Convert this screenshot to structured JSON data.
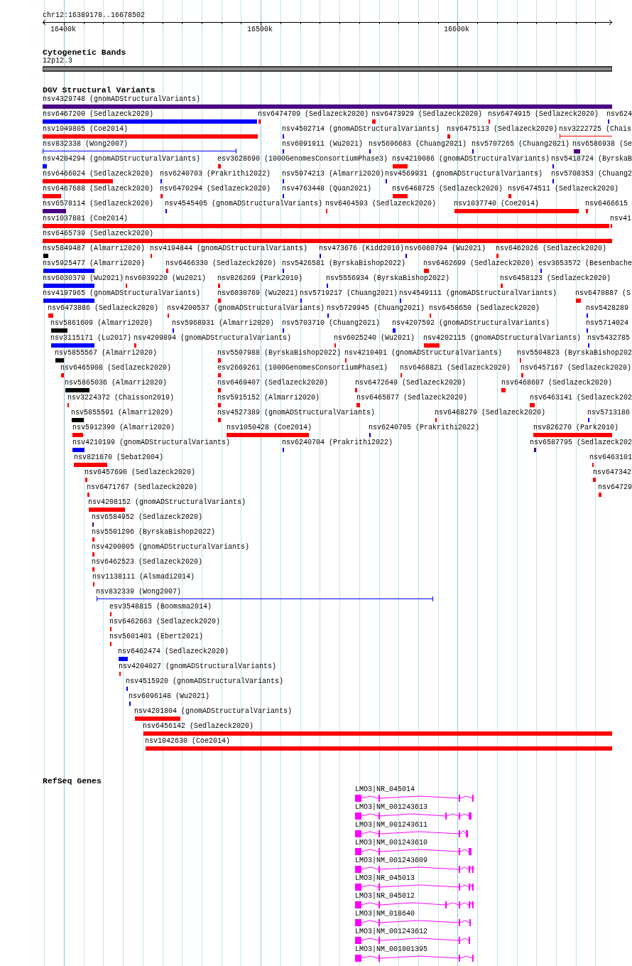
{
  "ruler": {
    "region": "chr12:16389178..16678502",
    "ticks": [
      "16400k",
      "16500k",
      "16600k"
    ]
  },
  "cytogenetic_bands": {
    "title": "Cytogenetic Bands",
    "band": {
      "label": "12p12.3"
    }
  },
  "dgv_structural_variants": {
    "title": "DGV Structural Variants",
    "rows": [
      {
        "features": [
          {
            "label": "nsv4329748 (gnomADStructuralVariants)",
            "color": "#4b0082",
            "kind": "bar"
          }
        ]
      },
      {
        "features": [
          {
            "label": "nsv6467200 (Sedlazeck2020)",
            "color": "#0000ff",
            "kind": "bar"
          },
          {
            "label": "nsv6474709 (Sedlazeck2020)",
            "color": "#ff0000",
            "kind": "bar"
          },
          {
            "label": "nsv6473929 (Sedlazeck2020)",
            "color": "#ff0000",
            "kind": "bar"
          },
          {
            "label": "nsv6474915 (Sedlazeck2020)",
            "color": "#ff0000",
            "kind": "bar"
          },
          {
            "label": "nsv624",
            "color": "#0000ff",
            "kind": "bar"
          }
        ]
      },
      {
        "features": [
          {
            "label": "nsv1049805 (Coe2014)",
            "color": "#ff0000",
            "kind": "bar"
          },
          {
            "label": "nsv4502714 (gnomADStructuralVariants)",
            "color": "#0000ff",
            "kind": "bar"
          },
          {
            "label": "nsv6475113 (Sedlazeck2020)",
            "color": "#ff0000",
            "kind": "bar"
          },
          {
            "label": "nsv3222725 (Chais",
            "color": "#ff0000",
            "kind": "span"
          }
        ]
      },
      {
        "features": [
          {
            "label": "nsv832338 (Wong2007)",
            "color": "#0000ff",
            "kind": "span"
          },
          {
            "label": "nsv6091911 (Wu2021)",
            "color": "#0000ff",
            "kind": "bar"
          },
          {
            "label": "nsv5696683 (Chuang2021)",
            "color": "#0000ff",
            "kind": "bar"
          },
          {
            "label": "nsv5707265 (Chuang2021)",
            "color": "#0000ff",
            "kind": "bar"
          },
          {
            "label": "nsv6586938 (Se",
            "color": "#4b0082",
            "kind": "bar"
          }
        ]
      },
      {
        "features": [
          {
            "label": "nsv4204294 (gnomADStructuralVariants)",
            "color": "#0000ff",
            "kind": "bar"
          },
          {
            "label": "esv3628690 (1000GenomesConsortiumPhase3)",
            "color": "#ff0000",
            "kind": "bar"
          },
          {
            "label": "nsv4210086 (gnomADStructuralVariants)",
            "color": "#ff0000",
            "kind": "bar"
          },
          {
            "label": "nsv5418724 (ByrskaB",
            "color": "#0000ff",
            "kind": "bar"
          }
        ]
      },
      {
        "features": [
          {
            "label": "nsv6466024 (Sedlazeck2020)",
            "color": "#ff0000",
            "kind": "bar"
          },
          {
            "label": "nsv6240703 (Prakrithi2022)",
            "color": "#0000ff",
            "kind": "bar"
          },
          {
            "label": "nsv5974213 (Almarri2020)",
            "color": "#0000ff",
            "kind": "bar"
          },
          {
            "label": "nsv4569931 (gnomADStructuralVariants)",
            "color": "#0000ff",
            "kind": "bar"
          },
          {
            "label": "nsv5708353 (Chuang2",
            "color": "#0000ff",
            "kind": "bar"
          }
        ]
      },
      {
        "features": [
          {
            "label": "nsv6467688 (Sedlazeck2020)",
            "color": "#ff0000",
            "kind": "bar"
          },
          {
            "label": "nsv6470294 (Sedlazeck2020)",
            "color": "#ff0000",
            "kind": "bar"
          },
          {
            "label": "nsv4763448 (Quan2021)",
            "color": "#0000ff",
            "kind": "bar"
          },
          {
            "label": "nsv6468725 (Sedlazeck2020)",
            "color": "#ff0000",
            "kind": "bar"
          },
          {
            "label": "nsv6474511 (Sedlazeck2020)",
            "color": "#ff0000",
            "kind": "bar"
          }
        ]
      },
      {
        "features": [
          {
            "label": "nsv6578114 (Sedlazeck2020)",
            "color": "#4b0082",
            "kind": "bar"
          },
          {
            "label": "nsv4545405 (gnomADStructuralVariants)",
            "color": "#0000ff",
            "kind": "bar"
          },
          {
            "label": "nsv6464593 (Sedlazeck2020)",
            "color": "#ff0000",
            "kind": "bar"
          },
          {
            "label": "nsv1037740 (Coe2014)",
            "color": "#ff0000",
            "kind": "bar"
          },
          {
            "label": "nsv6466615",
            "color": "#ff0000",
            "kind": "bar"
          }
        ]
      },
      {
        "features": [
          {
            "label": "nsv1037881 (Coe2014)",
            "color": "#ff0000",
            "kind": "bar"
          },
          {
            "label": "nsv41",
            "color": "#ff0000",
            "kind": "bar"
          }
        ]
      },
      {
        "features": [
          {
            "label": "nsv6465739 (Sedlazeck2020)",
            "color": "#ff0000",
            "kind": "bar"
          }
        ]
      },
      {
        "features": [
          {
            "label": "nsv5849487 (Almarri2020)",
            "color": "#000000",
            "kind": "bar"
          },
          {
            "label": "nsv4194844 (gnomADStructuralVariants)",
            "color": "#ff0000",
            "kind": "bar"
          },
          {
            "label": "nsv473676 (Kidd2010)",
            "color": "#0000ff",
            "kind": "bar"
          },
          {
            "label": "nsv6080794 (Wu2021)",
            "color": "#0000ff",
            "kind": "bar"
          },
          {
            "label": "nsv6462026 (Sedlazeck2020)",
            "color": "#ff0000",
            "kind": "bar"
          }
        ]
      },
      {
        "features": [
          {
            "label": "nsv5925477 (Almarri2020)",
            "color": "#0000ff",
            "kind": "bar"
          },
          {
            "label": "nsv6466330 (Sedlazeck2020)",
            "color": "#ff0000",
            "kind": "bar"
          },
          {
            "label": "nsv5426581 (ByrskaBishop2022)",
            "color": "#0000ff",
            "kind": "bar"
          },
          {
            "label": "nsv6462699 (Sedlazeck2020)",
            "color": "#ff0000",
            "kind": "bar"
          },
          {
            "label": "esv3653572 (Besenbache",
            "color": "#0000ff",
            "kind": "bar"
          }
        ]
      },
      {
        "features": [
          {
            "label": "nsv6030379 (Wu2021)",
            "color": "#0000ff",
            "kind": "bar"
          },
          {
            "label": "nsv6039220 (Wu2021)",
            "color": "#ff0000",
            "kind": "bar"
          },
          {
            "label": "nsv826269 (Park2010)",
            "color": "#ff0000",
            "kind": "bar"
          },
          {
            "label": "nsv5556934 (ByrskaBishop2022)",
            "color": "#0000ff",
            "kind": "bar"
          },
          {
            "label": "nsv6458123 (Sedlazeck2020)",
            "color": "#ff0000",
            "kind": "bar"
          }
        ]
      },
      {
        "features": [
          {
            "label": "nsv4197965 (gnomADStructuralVariants)",
            "color": "#0000ff",
            "kind": "bar"
          },
          {
            "label": "nsv6030769 (Wu2021)",
            "color": "#ff0000",
            "kind": "bar"
          },
          {
            "label": "nsv5719217 (Chuang2021)",
            "color": "#0000ff",
            "kind": "bar"
          },
          {
            "label": "nsv4549111 (gnomADStructuralVariants)",
            "color": "#0000ff",
            "kind": "bar"
          },
          {
            "label": "nsv6470887 (S",
            "color": "#ff0000",
            "kind": "bar"
          }
        ]
      },
      {
        "features": [
          {
            "label": "nsv6473886 (Sedlazeck2020)",
            "color": "#ff0000",
            "kind": "bar"
          },
          {
            "label": "nsv4200537 (gnomADStructuralVariants)",
            "color": "#ff0000",
            "kind": "bar"
          },
          {
            "label": "nsv5729945 (Chuang2021)",
            "color": "#0000ff",
            "kind": "bar"
          },
          {
            "label": "nsv6458650 (Sedlazeck2020)",
            "color": "#ff0000",
            "kind": "bar"
          },
          {
            "label": "nsv5428289",
            "color": "#0000ff",
            "kind": "bar"
          }
        ]
      },
      {
        "features": [
          {
            "label": "nsv5861609 (Almarri2020)",
            "color": "#000000",
            "kind": "bar"
          },
          {
            "label": "nsv5968931 (Almarri2020)",
            "color": "#0000ff",
            "kind": "bar"
          },
          {
            "label": "nsv5703710 (Chuang2021)",
            "color": "#0000ff",
            "kind": "bar"
          },
          {
            "label": "nsv4207592 (gnomADStructuralVariants)",
            "color": "#0000ff",
            "kind": "bar"
          },
          {
            "label": "nsv5714024",
            "color": "#0000ff",
            "kind": "bar"
          }
        ]
      },
      {
        "features": [
          {
            "label": "nsv3115171 (Lu2017)",
            "color": "#0000ff",
            "kind": "bar"
          },
          {
            "label": "nsv4209894 (gnomADStructuralVariants)",
            "color": "#ff0000",
            "kind": "bar"
          },
          {
            "label": "nsv6025240 (Wu2021)",
            "color": "#ff0000",
            "kind": "bar"
          },
          {
            "label": "nsv4202115 (gnomADStructuralVariants)",
            "color": "#ff0000",
            "kind": "bar"
          },
          {
            "label": "nsv5432785",
            "color": "#0000ff",
            "kind": "bar"
          }
        ]
      },
      {
        "features": [
          {
            "label": "nsv5855567 (Almarri2020)",
            "color": "#000000",
            "kind": "bar"
          },
          {
            "label": "nsv5507988 (ByrskaBishop2022)",
            "color": "#ff0000",
            "kind": "bar"
          },
          {
            "label": "nsv4210401 (gnomADStructuralVariants)",
            "color": "#ff0000",
            "kind": "bar"
          },
          {
            "label": "nsv5504823 (ByrskaBishop202",
            "color": "#ff0000",
            "kind": "bar"
          }
        ]
      },
      {
        "features": [
          {
            "label": "nsv6465908 (Sedlazeck2020)",
            "color": "#ff0000",
            "kind": "bar"
          },
          {
            "label": "esv2669261 (1000GenomesConsortiumPhase1)",
            "color": "#ff0000",
            "kind": "bar"
          },
          {
            "label": "nsv6468821 (Sedlazeck2020)",
            "color": "#ff0000",
            "kind": "bar"
          },
          {
            "label": "nsv6457167 (Sedlazeck2020)",
            "color": "#ff0000",
            "kind": "bar"
          }
        ]
      },
      {
        "features": [
          {
            "label": "nsv5865036 (Almarri2020)",
            "color": "#000000",
            "kind": "bar"
          },
          {
            "label": "nsv6469407 (Sedlazeck2020)",
            "color": "#ff0000",
            "kind": "bar"
          },
          {
            "label": "nsv6472649 (Sedlazeck2020)",
            "color": "#ff0000",
            "kind": "bar"
          },
          {
            "label": "nsv6468607 (Sedlazeck2020)",
            "color": "#ff0000",
            "kind": "bar"
          }
        ]
      },
      {
        "features": [
          {
            "label": "nsv3224372 (Chaisson2019)",
            "color": "#ff0000",
            "kind": "bar"
          },
          {
            "label": "nsv5915152 (Almarri2020)",
            "color": "#ff0000",
            "kind": "bar"
          },
          {
            "label": "nsv6465877 (Sedlazeck2020)",
            "color": "#ff0000",
            "kind": "bar"
          },
          {
            "label": "nsv6463141 (Sedlazeck202",
            "color": "#ff0000",
            "kind": "bar"
          }
        ]
      },
      {
        "features": [
          {
            "label": "nsv5855591 (Almarri2020)",
            "color": "#000000",
            "kind": "bar"
          },
          {
            "label": "nsv4527389 (gnomADStructuralVariants)",
            "color": "#ff0000",
            "kind": "bar"
          },
          {
            "label": "nsv6468279 (Sedlazeck2020)",
            "color": "#ff0000",
            "kind": "bar"
          },
          {
            "label": "nsv5713186",
            "color": "#0000ff",
            "kind": "bar"
          }
        ]
      },
      {
        "features": [
          {
            "label": "nsv5912390 (Almarri2020)",
            "color": "#ff0000",
            "kind": "bar"
          },
          {
            "label": "nsv1050428 (Coe2014)",
            "color": "#ff0000",
            "kind": "bar"
          },
          {
            "label": "nsv6240705 (Prakrithi2022)",
            "color": "#0000ff",
            "kind": "bar"
          },
          {
            "label": "nsv826270 (Park2010)",
            "color": "#ff0000",
            "kind": "bar"
          }
        ]
      },
      {
        "features": [
          {
            "label": "nsv4210199 (gnomADStructuralVariants)",
            "color": "#0000ff",
            "kind": "bar"
          },
          {
            "label": "nsv6240704 (Prakrithi2022)",
            "color": "#0000ff",
            "kind": "bar"
          },
          {
            "label": "nsv6587795 (Sedlazeck202",
            "color": "#4b0082",
            "kind": "bar"
          }
        ]
      },
      {
        "features": [
          {
            "label": "nsv821670 (Sebat2004)",
            "color": "#ff0000",
            "kind": "bar"
          },
          {
            "label": "nsv6463101",
            "color": "#ff0000",
            "kind": "bar"
          }
        ]
      },
      {
        "features": [
          {
            "label": "nsv6457690 (Sedlazeck2020)",
            "color": "#ff0000",
            "kind": "bar"
          },
          {
            "label": "nsv647342",
            "color": "#ff0000",
            "kind": "bar"
          }
        ]
      },
      {
        "features": [
          {
            "label": "nsv6471767 (Sedlazeck2020)",
            "color": "#ff0000",
            "kind": "bar"
          },
          {
            "label": "nsv64729",
            "color": "#ff0000",
            "kind": "bar"
          }
        ]
      },
      {
        "features": [
          {
            "label": "nsv4208152 (gnomADStructuralVariants)",
            "color": "#ff0000",
            "kind": "bar"
          }
        ]
      },
      {
        "features": [
          {
            "label": "nsv6584952 (Sedlazeck2020)",
            "color": "#4b0082",
            "kind": "bar"
          }
        ]
      },
      {
        "features": [
          {
            "label": "nsv5501206 (ByrskaBishop2022)",
            "color": "#ff0000",
            "kind": "bar"
          }
        ]
      },
      {
        "features": [
          {
            "label": "nsv4200005 (gnomADStructuralVariants)",
            "color": "#ff0000",
            "kind": "bar"
          }
        ]
      },
      {
        "features": [
          {
            "label": "nsv6462523 (Sedlazeck2020)",
            "color": "#ff0000",
            "kind": "bar"
          }
        ]
      },
      {
        "features": [
          {
            "label": "nsv1138111 (Alsmadi2014)",
            "color": "#ff0000",
            "kind": "bar"
          }
        ]
      },
      {
        "features": [
          {
            "label": "nsv832339 (Wong2007)",
            "color": "#0000ff",
            "kind": "span"
          }
        ]
      },
      {
        "features": [
          {
            "label": "esv3548815 (Boomsma2014)",
            "color": "#ff0000",
            "kind": "bar"
          }
        ]
      },
      {
        "features": [
          {
            "label": "nsv6462663 (Sedlazeck2020)",
            "color": "#ff0000",
            "kind": "bar"
          }
        ]
      },
      {
        "features": [
          {
            "label": "nsv5601401 (Ebert2021)",
            "color": "#ff0000",
            "kind": "bar"
          }
        ]
      },
      {
        "features": [
          {
            "label": "nsv6462474 (Sedlazeck2020)",
            "color": "#0000ff",
            "kind": "bar"
          }
        ]
      },
      {
        "features": [
          {
            "label": "nsv4204027 (gnomADStructuralVariants)",
            "color": "#ff0000",
            "kind": "bar"
          }
        ]
      },
      {
        "features": [
          {
            "label": "nsv4515920 (gnomADStructuralVariants)",
            "color": "#0000ff",
            "kind": "bar"
          }
        ]
      },
      {
        "features": [
          {
            "label": "nsv6096148 (Wu2021)",
            "color": "#0000ff",
            "kind": "bar"
          }
        ]
      },
      {
        "features": [
          {
            "label": "nsv4201804 (gnomADStructuralVariants)",
            "color": "#ff0000",
            "kind": "bar"
          }
        ]
      },
      {
        "features": [
          {
            "label": "nsv6456142 (Sedlazeck2020)",
            "color": "#ff0000",
            "kind": "bar"
          }
        ]
      },
      {
        "features": [
          {
            "label": "nsv1042630 (Coe2014)",
            "color": "#ff0000",
            "kind": "bar"
          }
        ]
      }
    ]
  },
  "refseq_genes": {
    "title": "RefSeq Genes",
    "transcripts": [
      {
        "label": "LMO3|NR_045014"
      },
      {
        "label": "LMO3|NM_001243613"
      },
      {
        "label": "LMO3|NM_001243611"
      },
      {
        "label": "LMO3|NM_001243610"
      },
      {
        "label": "LMO3|NM_001243609"
      },
      {
        "label": "LMO3|NR_045013"
      },
      {
        "label": "LMO3|NR_045012"
      },
      {
        "label": "LMO3|NM_018640"
      },
      {
        "label": "LMO3|NM_001243612"
      },
      {
        "label": "LMO3|NM_001001395"
      }
    ]
  }
}
